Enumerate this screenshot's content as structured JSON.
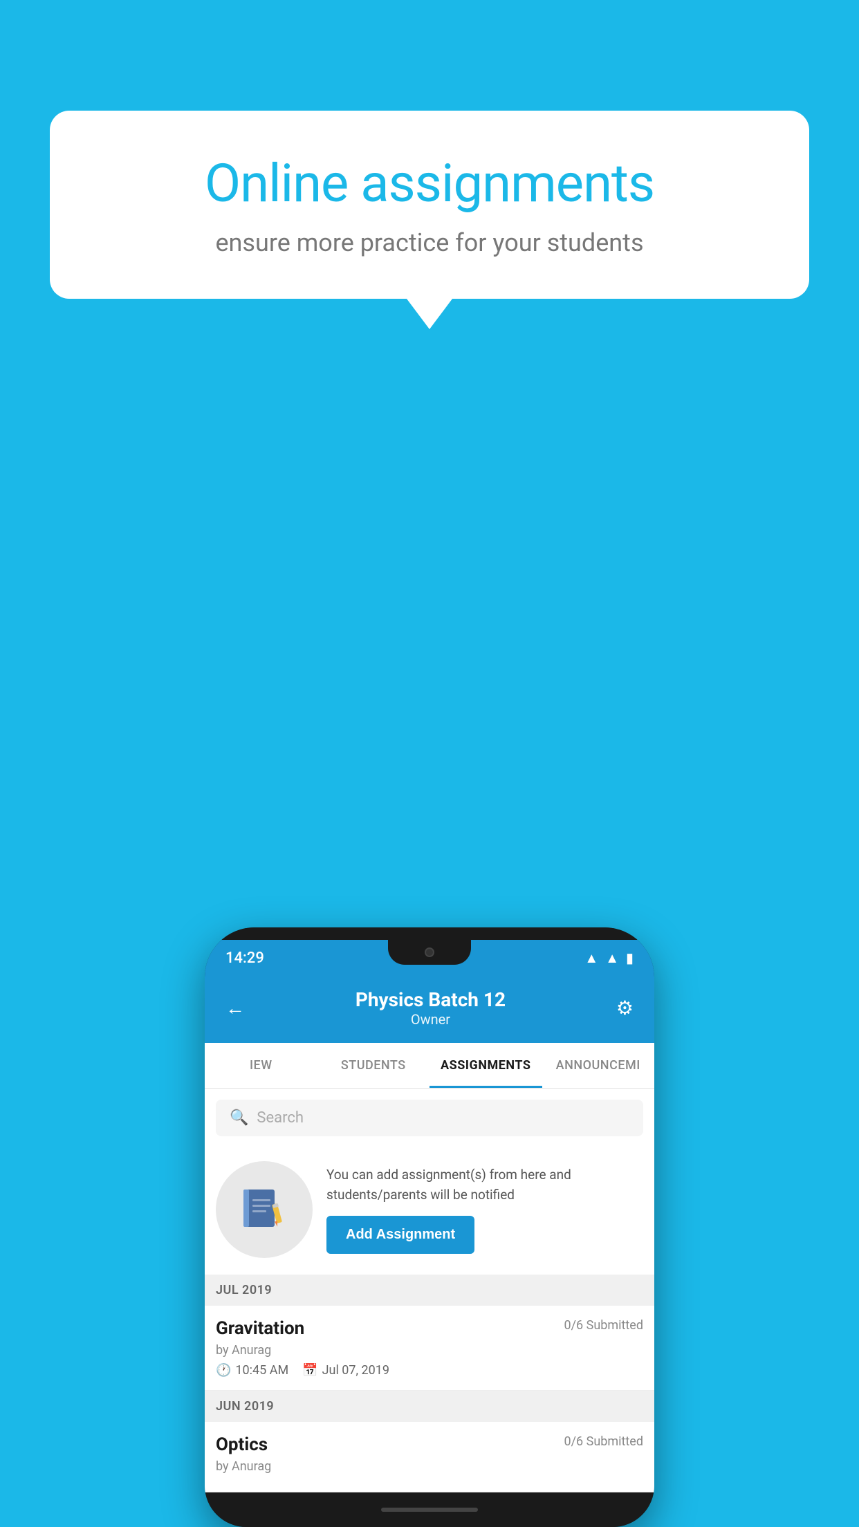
{
  "background_color": "#1BB8E8",
  "speech_bubble": {
    "title": "Online assignments",
    "subtitle": "ensure more practice for your students"
  },
  "status_bar": {
    "time": "14:29",
    "icons": [
      "wifi",
      "signal",
      "battery"
    ]
  },
  "app_header": {
    "title": "Physics Batch 12",
    "subtitle": "Owner",
    "back_label": "←",
    "settings_label": "⚙"
  },
  "tabs": [
    {
      "label": "IEW",
      "active": false
    },
    {
      "label": "STUDENTS",
      "active": false
    },
    {
      "label": "ASSIGNMENTS",
      "active": true
    },
    {
      "label": "ANNOUNCEMENTS",
      "active": false
    }
  ],
  "search": {
    "placeholder": "Search"
  },
  "add_assignment": {
    "description": "You can add assignment(s) from here and students/parents will be notified",
    "button_label": "Add Assignment"
  },
  "sections": [
    {
      "label": "JUL 2019",
      "assignments": [
        {
          "name": "Gravitation",
          "submitted": "0/6 Submitted",
          "by": "by Anurag",
          "time": "10:45 AM",
          "date": "Jul 07, 2019"
        }
      ]
    },
    {
      "label": "JUN 2019",
      "assignments": [
        {
          "name": "Optics",
          "submitted": "0/6 Submitted",
          "by": "by Anurag",
          "time": "",
          "date": ""
        }
      ]
    }
  ]
}
